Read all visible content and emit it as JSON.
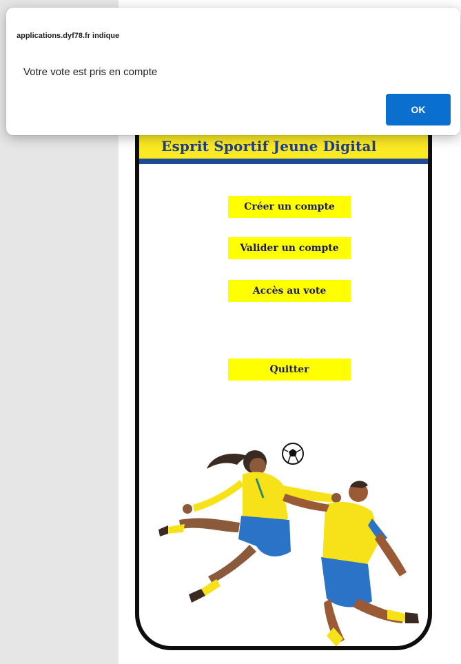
{
  "dialog": {
    "origin": "applications.dyf78.fr indique",
    "message": "Votre vote est pris en compte",
    "ok_label": "OK"
  },
  "app": {
    "title": "Esprit Sportif Jeune Digital",
    "menu": {
      "create_account": "Créer un compte",
      "validate_account": "Valider un compte",
      "vote_access": "Accès au vote",
      "quit": "Quitter"
    }
  },
  "colors": {
    "header_yellow": "#fbea23",
    "header_blue": "#1f4b94",
    "button_yellow": "#ffff00",
    "ok_blue": "#0b6fd0"
  }
}
